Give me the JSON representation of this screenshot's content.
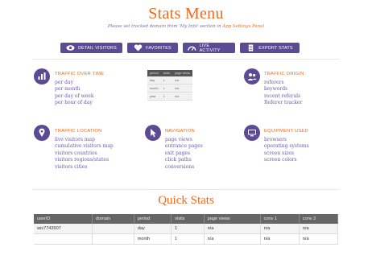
{
  "page": {
    "title": "Stats Menu",
    "subtitle_prefix": "Please set tracked domain from 'My Info' section in ",
    "subtitle_link": "App Settings Panel"
  },
  "toolbar": {
    "detail_visitors": "DETAIL VISITORS",
    "favorites": "FAVORITES",
    "live_activity": "LIVE ACTIVITY",
    "export_stats": "EXPORT STATS"
  },
  "sections": {
    "traffic_over_time": {
      "title": "TRAFFIC OVER TIME",
      "items": [
        "per day",
        "per month",
        "per day of week",
        "per hour of day"
      ]
    },
    "traffic_origin": {
      "title": "TRAFFIC ORIGIN",
      "items": [
        "referers",
        "keywords",
        "recent referals",
        "Referer tracker"
      ]
    },
    "traffic_location": {
      "title": "TRAFFIC LOCATION",
      "items": [
        "live visitors map",
        "cumulative visitors map",
        "visitors countries",
        "visitors regions/states",
        "visitors cities"
      ]
    },
    "navigation": {
      "title": "NAVIGATION",
      "items": [
        "page views",
        "entrance pages",
        "exit pages",
        "click paths",
        "conversions"
      ]
    },
    "equipment_used": {
      "title": "EQUIPMENT USED",
      "items": [
        "browsers",
        "operating systems",
        "screen sizes",
        "screen colors"
      ]
    }
  },
  "mini_table": {
    "headers": [
      "period",
      "visits",
      "page views"
    ],
    "rows": [
      [
        "day",
        "1",
        "n/a"
      ],
      [
        "month",
        "1",
        "n/a"
      ],
      [
        "year",
        "1",
        "n/a"
      ]
    ]
  },
  "quick_stats": {
    "title": "Quick Stats",
    "headers": [
      "userID",
      "domain",
      "period",
      "visits",
      "page views",
      "conv 1",
      "conv 2"
    ],
    "rows": [
      [
        "wix7743507",
        "",
        "day",
        "1",
        "n/a",
        "n/a",
        "n/a"
      ],
      [
        "",
        "",
        "month",
        "1",
        "n/a",
        "n/a",
        "n/a"
      ]
    ]
  },
  "colors": {
    "accent": "#f06a1c",
    "brand": "#5b4a94"
  }
}
